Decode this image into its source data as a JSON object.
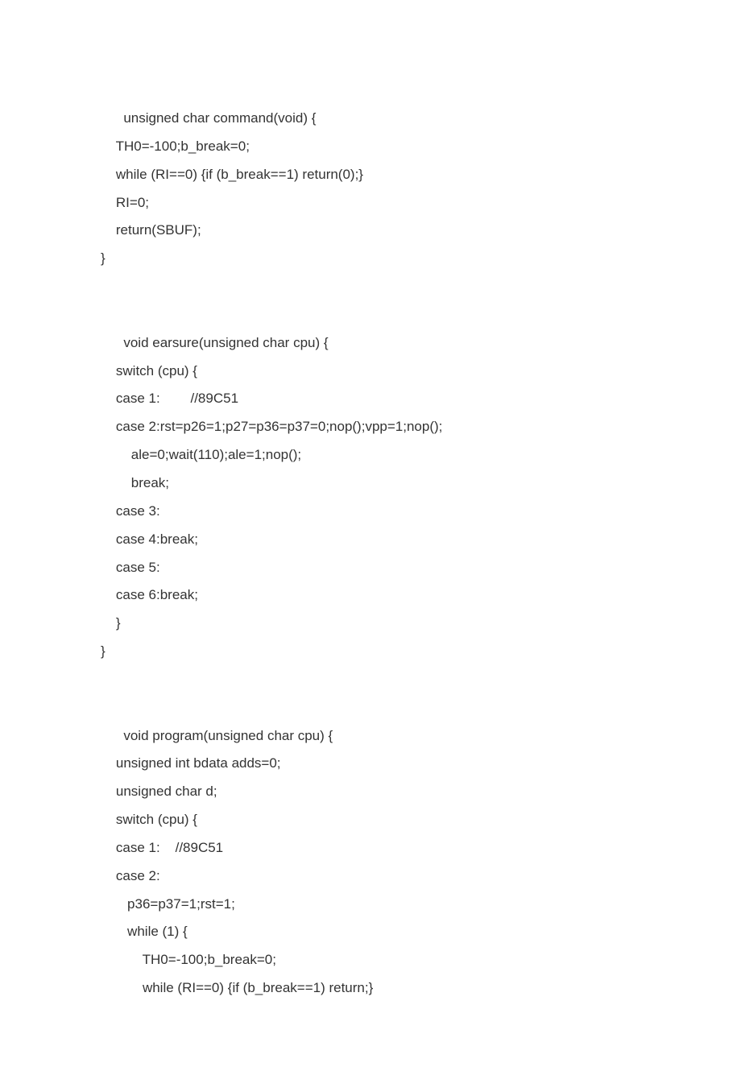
{
  "code": "      unsigned char command(void) {\n    TH0=-100;b_break=0;\n    while (RI==0) {if (b_break==1) return(0);}\n    RI=0;\n    return(SBUF);\n}\n\n\n      void earsure(unsigned char cpu) {\n    switch (cpu) {\n    case 1:        //89C51\n    case 2:rst=p26=1;p27=p36=p37=0;nop();vpp=1;nop();\n        ale=0;wait(110);ale=1;nop();\n        break;\n    case 3:\n    case 4:break;\n    case 5:\n    case 6:break;\n    }\n}\n\n\n      void program(unsigned char cpu) {\n    unsigned int bdata adds=0;\n    unsigned char d;\n    switch (cpu) {\n    case 1:    //89C51\n    case 2:\n       p36=p37=1;rst=1;\n       while (1) {\n           TH0=-100;b_break=0;\n           while (RI==0) {if (b_break==1) return;}"
}
